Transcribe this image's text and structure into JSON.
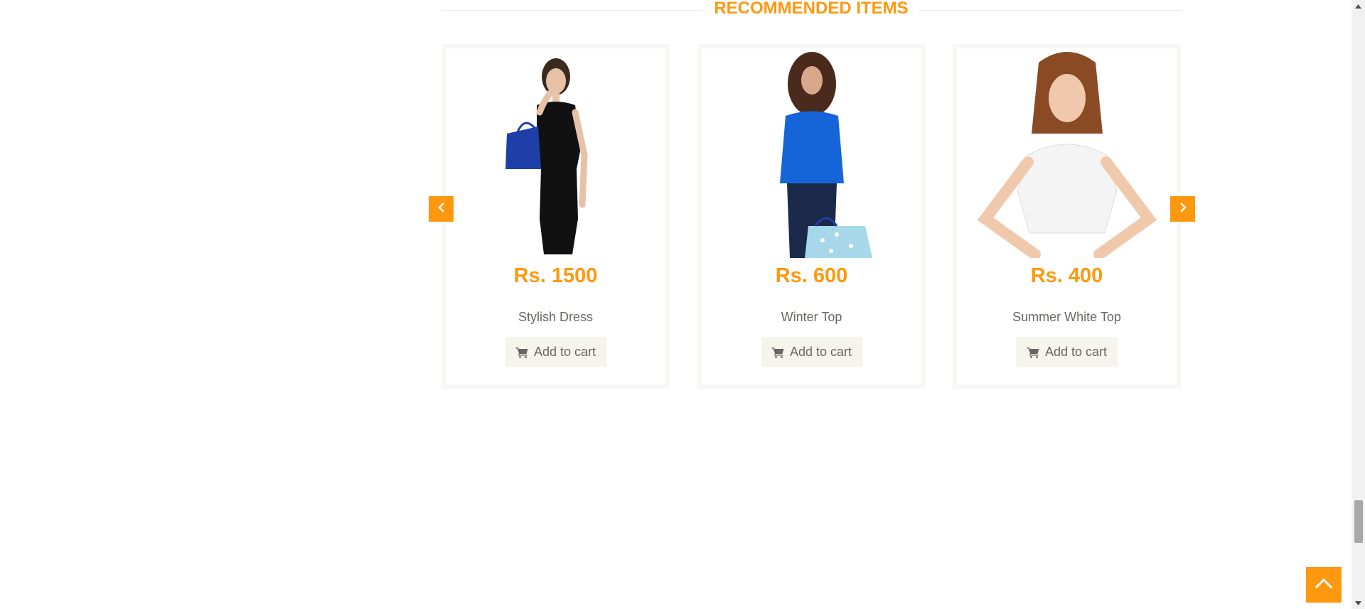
{
  "section": {
    "title": "RECOMMENDED ITEMS"
  },
  "products": [
    {
      "price": "Rs. 1500",
      "name": "Stylish Dress",
      "cart_label": "Add to cart"
    },
    {
      "price": "Rs. 600",
      "name": "Winter Top",
      "cart_label": "Add to cart"
    },
    {
      "price": "Rs. 400",
      "name": "Summer White Top",
      "cart_label": "Add to cart"
    }
  ],
  "icons": {
    "carousel_prev": "chevron-left-icon",
    "carousel_next": "chevron-right-icon",
    "cart": "shopping-cart-icon",
    "scroll_up": "chevron-up-icon"
  },
  "colors": {
    "accent": "#fe980f",
    "text": "#696763",
    "button_bg": "#f5f5ed",
    "card_border": "#f7f7f5"
  }
}
